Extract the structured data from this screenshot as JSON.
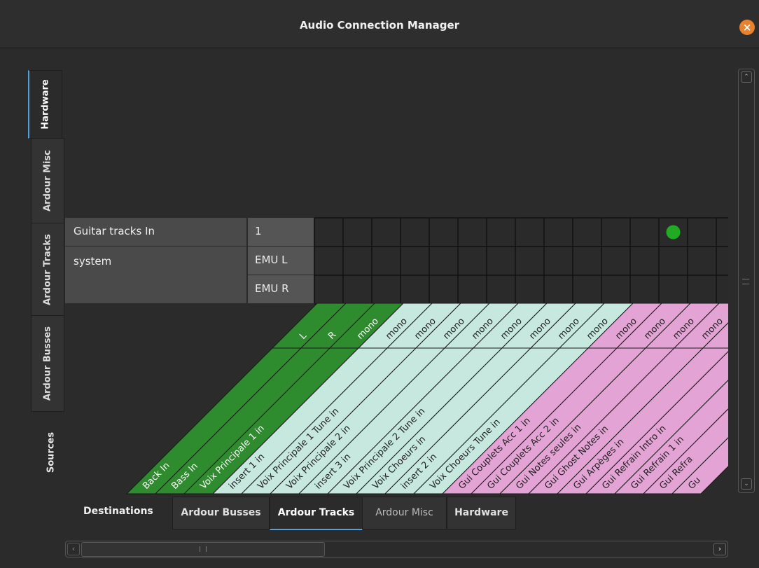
{
  "window": {
    "title": "Audio Connection Manager",
    "close_icon": "×"
  },
  "sources": {
    "label": "Sources",
    "tabs": [
      "Hardware",
      "Ardour Misc",
      "Ardour Tracks",
      "Ardour Busses"
    ],
    "active_tab": "Hardware"
  },
  "destinations": {
    "label": "Destinations",
    "tabs": [
      "Ardour Busses",
      "Ardour Tracks",
      "Ardour Misc",
      "Hardware"
    ],
    "active_tab": "Ardour Tracks"
  },
  "rows": [
    {
      "bundle": "Guitar tracks In",
      "ports": [
        "1"
      ]
    },
    {
      "bundle": "system",
      "ports": [
        "EMU L",
        "EMU R"
      ]
    }
  ],
  "columns": [
    {
      "bundle": "Back In",
      "port": "L",
      "color": "#2e8b2e"
    },
    {
      "bundle": "Bass In",
      "port": "R",
      "color": "#2e8b2e"
    },
    {
      "bundle": "Voix Principale 1 in",
      "port": "mono",
      "color": "#2e8b2e"
    },
    {
      "bundle": "insert 1 in",
      "port": "mono",
      "color": "#c6e8de"
    },
    {
      "bundle": "Voix Principale 1 Tune in",
      "port": "mono",
      "color": "#c6e8de"
    },
    {
      "bundle": "Voix Principale 2 in",
      "port": "mono",
      "color": "#c6e8de"
    },
    {
      "bundle": "insert 3 in",
      "port": "mono",
      "color": "#c6e8de"
    },
    {
      "bundle": "Voix Principale 2 Tune in",
      "port": "mono",
      "color": "#c6e8de"
    },
    {
      "bundle": "Voix Choeurs in",
      "port": "mono",
      "color": "#c6e8de"
    },
    {
      "bundle": "insert 2 in",
      "port": "mono",
      "color": "#c6e8de"
    },
    {
      "bundle": "Voix Choeurs Tune in",
      "port": "mono",
      "color": "#c6e8de"
    },
    {
      "bundle": "Gui Couplets Acc 1 in",
      "port": "mono",
      "color": "#e3a3d5"
    },
    {
      "bundle": "Gui Couplets Acc 2 in",
      "port": "mono",
      "color": "#e3a3d5"
    },
    {
      "bundle": "Gui Notes seules in",
      "port": "mono",
      "color": "#e3a3d5"
    },
    {
      "bundle": "Gui Ghost Notes in",
      "port": "mono",
      "color": "#e3a3d5"
    },
    {
      "bundle": "Gui Arpèges in",
      "port": "mono",
      "color": "#e3a3d5"
    },
    {
      "bundle": "Gui Refrain Intro in",
      "port": "",
      "color": "#e3a3d5"
    },
    {
      "bundle": "Gui Refrain 1 in",
      "port": "",
      "color": "#e3a3d5"
    },
    {
      "bundle": "Gui Refra",
      "port": "",
      "color": "#e3a3d5"
    },
    {
      "bundle": "Gu",
      "port": "",
      "color": "#e3a3d5"
    }
  ],
  "connections": [
    {
      "row_port": 0,
      "column": 12
    }
  ],
  "colors": {
    "connection_dot": "#22aa22",
    "accent": "#5a9fd4",
    "close": "#e8822c"
  }
}
